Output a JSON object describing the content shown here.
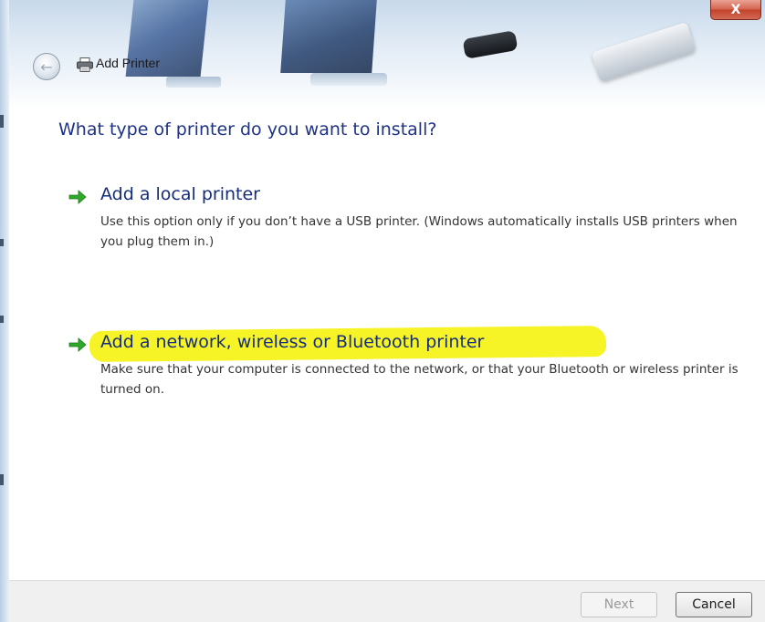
{
  "window": {
    "title": "Add Printer",
    "close_label": "X"
  },
  "content": {
    "heading": "What type of printer do you want to install?",
    "options": [
      {
        "title": "Add a local printer",
        "description": "Use this option only if you don’t have a USB printer. (Windows automatically installs USB printers when you plug them in.)",
        "icon": "green-arrow-icon",
        "highlighted": false
      },
      {
        "title": "Add a network, wireless or Bluetooth printer",
        "description": "Make sure that your computer is connected to the network, or that your Bluetooth or wireless printer is turned on.",
        "icon": "green-arrow-icon",
        "highlighted": true,
        "highlight_color": "#f6f326"
      }
    ]
  },
  "footer": {
    "next_label": "Next",
    "next_enabled": false,
    "cancel_label": "Cancel"
  },
  "colors": {
    "heading": "#1e3287",
    "option_title": "#152d7a",
    "arrow": "#2fa82a",
    "close_button": "#c94a34"
  },
  "icons": {
    "back": "back-arrow-icon",
    "printer": "printer-icon",
    "close": "close-icon"
  }
}
